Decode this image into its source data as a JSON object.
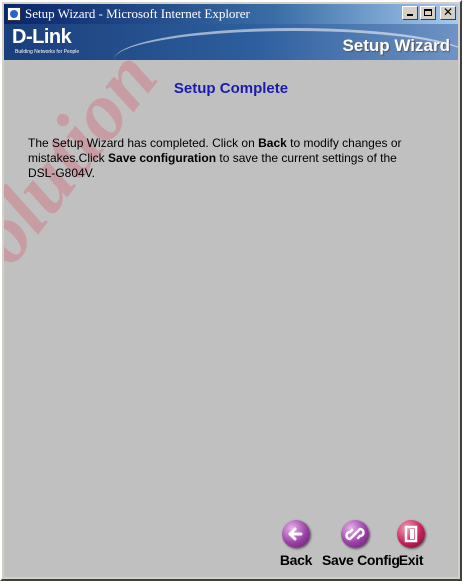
{
  "window": {
    "title": "Setup Wizard - Microsoft Internet Explorer"
  },
  "banner": {
    "logo": "D-Link",
    "tagline": "Building Networks for People",
    "title": "Setup Wizard"
  },
  "page": {
    "heading": "Setup Complete",
    "message_part1": "The Setup Wizard has completed. Click on ",
    "message_back": "Back",
    "message_part2": " to modify changes or mistakes.Click ",
    "message_save": "Save configuration",
    "message_part3": " to save the current settings of the DSL-G804V.",
    "watermark": "Adsl Solution"
  },
  "nav": {
    "back_label": "Back",
    "save_label": "Save Config",
    "exit_label": "Exit"
  },
  "colors": {
    "heading": "#1b1bb0",
    "nav_icon": "#9b3fa6",
    "exit_icon": "#c2205a",
    "watermark": "#d65a6e"
  }
}
